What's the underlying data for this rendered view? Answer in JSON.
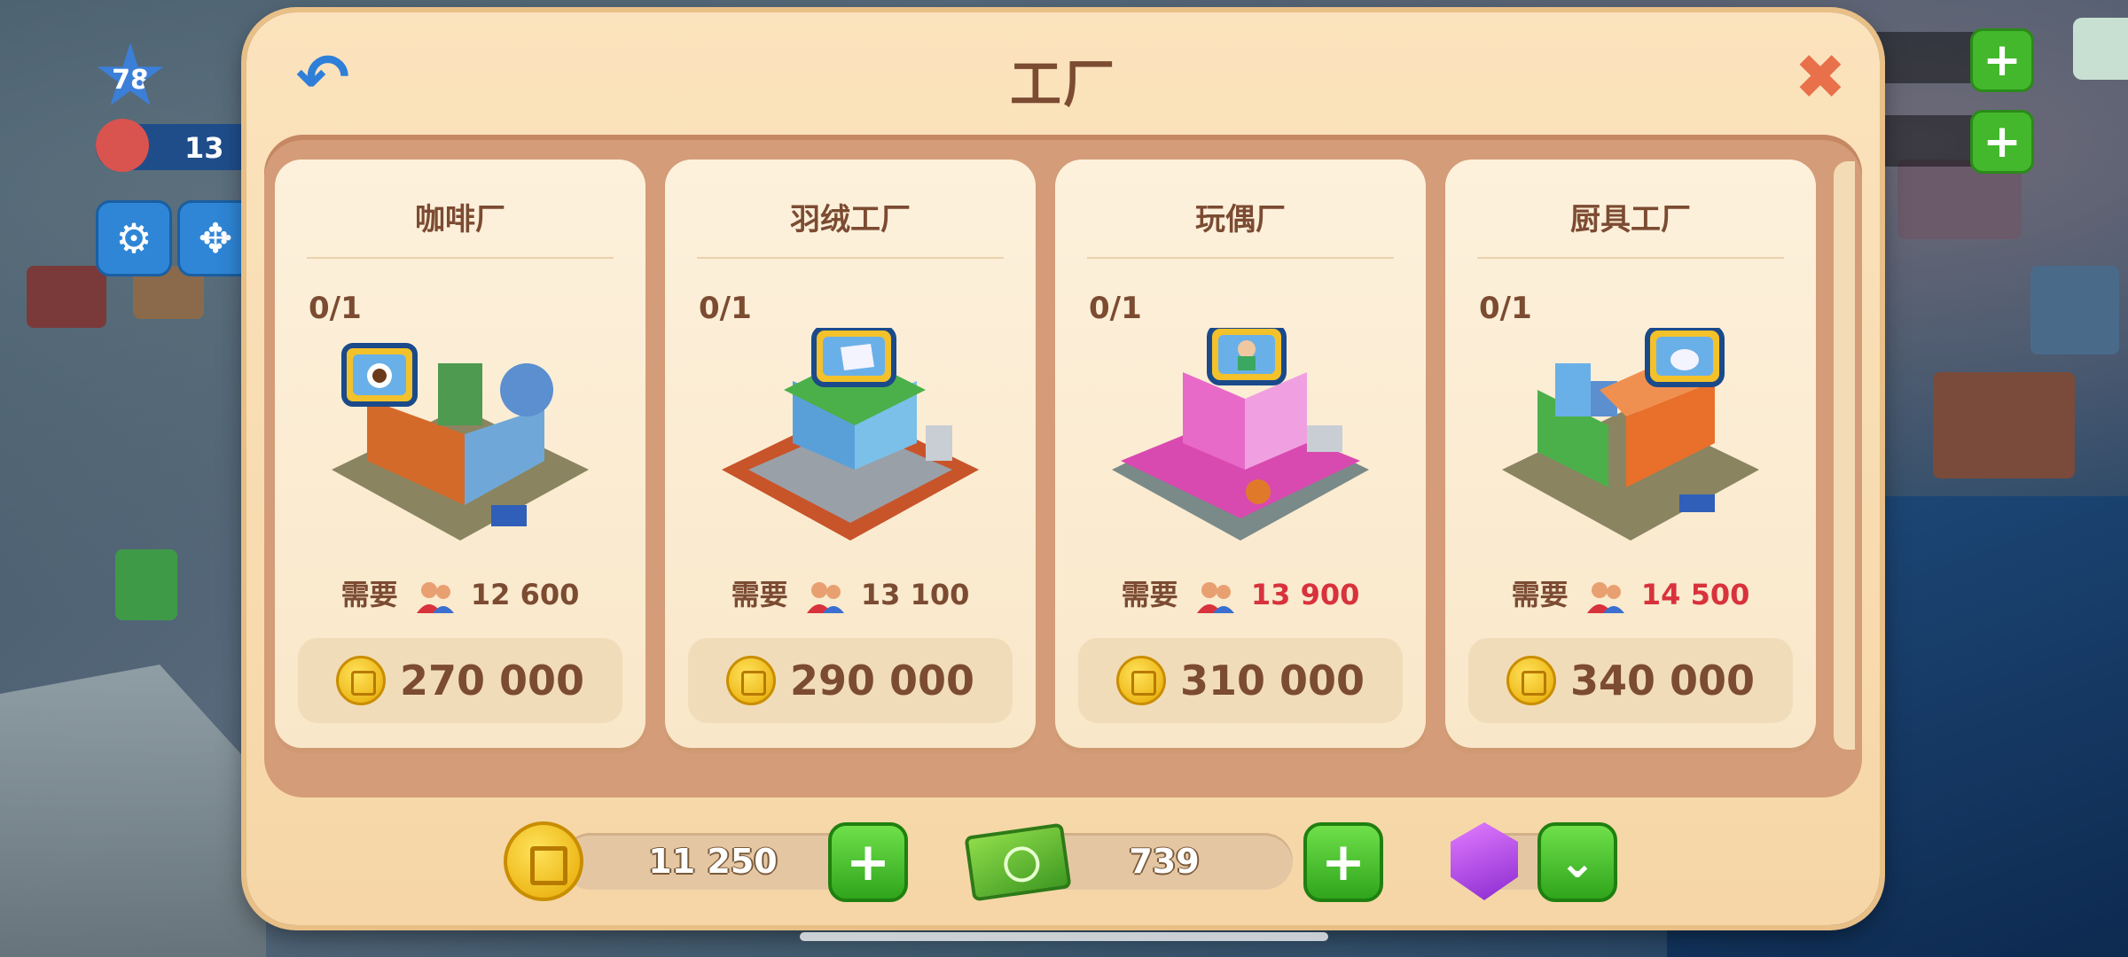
{
  "hud": {
    "level": "78",
    "population": "13",
    "coins_partial": "250",
    "cash_partial": "739"
  },
  "dialog": {
    "title": "工厂"
  },
  "cards": [
    {
      "name": "咖啡厂",
      "count": "0/1",
      "need_label": "需要",
      "need_value": "12 600",
      "need_color": "#7b4b32",
      "price": "270 000",
      "icon": "coffee-factory-icon"
    },
    {
      "name": "羽绒工厂",
      "count": "0/1",
      "need_label": "需要",
      "need_value": "13 100",
      "need_color": "#7b4b32",
      "price": "290 000",
      "icon": "down-factory-icon"
    },
    {
      "name": "玩偶厂",
      "count": "0/1",
      "need_label": "需要",
      "need_value": "13 900",
      "need_color": "#d8323c",
      "price": "310 000",
      "icon": "toy-factory-icon"
    },
    {
      "name": "厨具工厂",
      "count": "0/1",
      "need_label": "需要",
      "need_value": "14 500",
      "need_color": "#d8323c",
      "price": "340 000",
      "icon": "kitchenware-factory-icon"
    }
  ],
  "bottom": {
    "coins": "11 250",
    "cash": "739"
  }
}
